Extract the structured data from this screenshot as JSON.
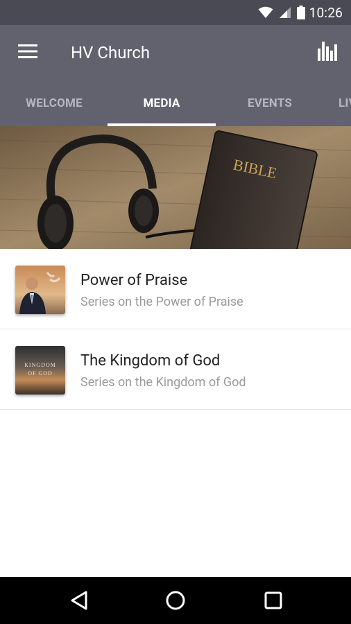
{
  "status_bar": {
    "time": "10:26",
    "icons": [
      "wifi-icon",
      "signal-icon",
      "battery-icon"
    ]
  },
  "app_bar": {
    "title": "HV Church",
    "menu_icon": "menu-icon",
    "action_icon": "bar-chart-icon"
  },
  "tabs": [
    {
      "label": "WELCOME",
      "active": false
    },
    {
      "label": "MEDIA",
      "active": true
    },
    {
      "label": "EVENTS",
      "active": false
    },
    {
      "label": "LIVE",
      "active": false
    }
  ],
  "hero": {
    "book_label": "BIBLE"
  },
  "media_list": [
    {
      "title": "Power of Praise",
      "subtitle": "Series on the Power of Praise"
    },
    {
      "title": "The Kingdom of God",
      "subtitle": "Series on the Kingdom of God",
      "thumb_text_line1": "KINGDOM",
      "thumb_text_line2": "OF GOD"
    }
  ],
  "nav_bar": {
    "buttons": [
      "back-icon",
      "home-icon",
      "recents-icon"
    ]
  },
  "colors": {
    "status_bar": "#4a4a55",
    "app_bar": "#62626f",
    "tab_inactive": "#b6b6c0",
    "tab_active": "#ffffff"
  }
}
